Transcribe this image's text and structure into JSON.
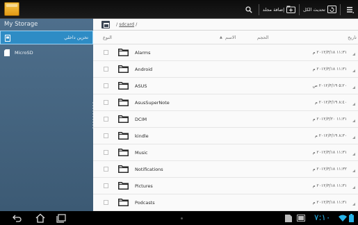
{
  "action_bar": {
    "new_folder_label": "إضافة مجلد",
    "refresh_label": "تحديث الكل"
  },
  "sidebar": {
    "title": "My Storage",
    "items": [
      {
        "label": "تخزين داخلي",
        "icon": "internal-storage-icon",
        "selected": true
      },
      {
        "label": "MicroSD",
        "icon": "sd-card-icon",
        "selected": false
      }
    ]
  },
  "path": {
    "separator": "/",
    "segment": "sdcard",
    "trailing": "/"
  },
  "columns": {
    "type": "النوع",
    "name": "الاسم",
    "size": "الحجم",
    "date": "تاريخ",
    "sort_indicator": "▲"
  },
  "files": [
    {
      "name": "Alarms",
      "date": "١١:٣١ ٢٠١٢/٣/١٨ م"
    },
    {
      "name": "Android",
      "date": "١١:٣١ ٢٠١٢/٣/١٨ م"
    },
    {
      "name": "ASUS",
      "date": "٥:٢٠ ٢٠١٢/٣/١٩ ص"
    },
    {
      "name": "AsusSuperNote",
      "date": "٨:٤٠ ٢٠١٢/٣/١٩ م"
    },
    {
      "name": "DCIM",
      "date": "١١:٣١ ٢٠١٢/٣/٢٠ م"
    },
    {
      "name": "kindle",
      "date": "٨:٣٠ ٢٠١٢/٣/١٩ م"
    },
    {
      "name": "Music",
      "date": "١١:٣١ ٢٠١٢/٣/١٨ م"
    },
    {
      "name": "Notifications",
      "date": "١١:٣٢ ٢٠١٢/٣/١٨ م"
    },
    {
      "name": "Pictures",
      "date": "١١:٣١ ٢٠١٢/٣/١٨ م"
    },
    {
      "name": "Podcasts",
      "date": "١١:٣١ ٢٠١٢/٣/١٨ م"
    }
  ],
  "status_bar": {
    "time": "٧:١٠"
  },
  "colors": {
    "selected_item": "#2e8cc5",
    "sidebar": "#4e6f8c",
    "status_accent": "#28b3e8"
  }
}
